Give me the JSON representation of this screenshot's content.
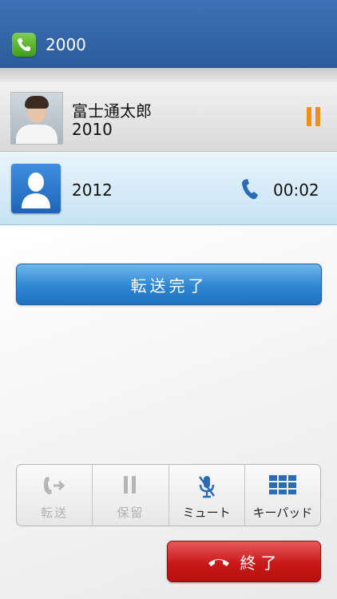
{
  "header": {
    "extension": "2000"
  },
  "calls": [
    {
      "name": "富士通太郎",
      "number": "2010",
      "state": "hold"
    },
    {
      "number": "2012",
      "duration": "00:02",
      "state": "active"
    }
  ],
  "actions": {
    "complete_transfer": "転送完了",
    "end_call": "終了"
  },
  "controls": [
    {
      "label": "転送",
      "icon": "transfer-icon",
      "enabled": false
    },
    {
      "label": "保留",
      "icon": "hold-icon",
      "enabled": false
    },
    {
      "label": "ミュート",
      "icon": "mic-muted-icon",
      "enabled": true
    },
    {
      "label": "キーパッド",
      "icon": "keypad-icon",
      "enabled": true
    }
  ],
  "colors": {
    "header": "#3d72b6",
    "primary": "#2f86d2",
    "danger": "#c91818",
    "hold": "#e8921c"
  }
}
